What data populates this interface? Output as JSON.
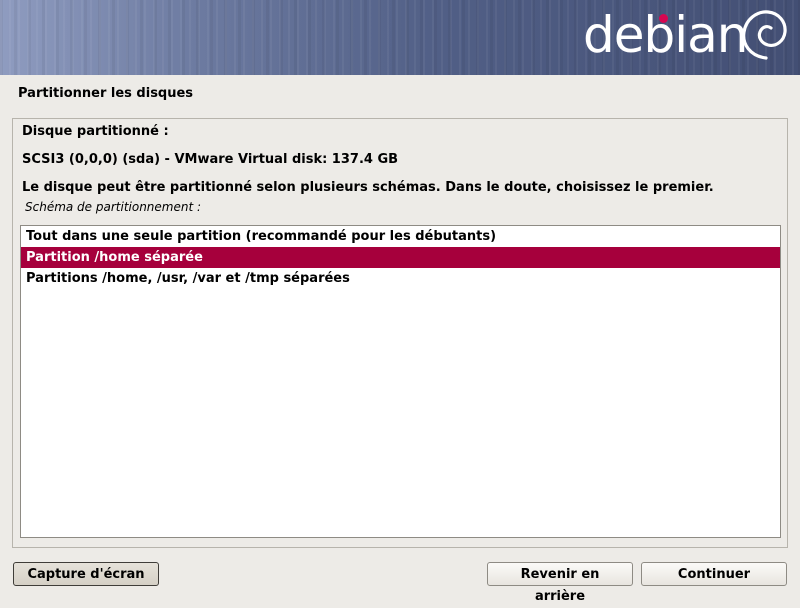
{
  "banner": {
    "brand": "debian",
    "dot_color": "#d70751"
  },
  "page": {
    "title": "Partitionner les disques"
  },
  "content": {
    "disk_heading": "Disque partitionné :",
    "disk_name": "SCSI3 (0,0,0) (sda) - VMware Virtual disk: 137.4 GB",
    "description": "Le disque peut être partitionné selon plusieurs schémas. Dans le doute, choisissez le premier.",
    "scheme_label": "Schéma de partitionnement :"
  },
  "listbox": {
    "items": [
      {
        "label": "Tout dans une seule partition (recommandé pour les débutants)",
        "selected": false
      },
      {
        "label": "Partition /home séparée",
        "selected": true
      },
      {
        "label": "Partitions /home, /usr, /var et /tmp séparées",
        "selected": false
      }
    ],
    "selected_color": "#a6003c"
  },
  "buttons": {
    "screenshot": "Capture d'écran",
    "back": "Revenir en arrière",
    "continue": "Continuer"
  }
}
